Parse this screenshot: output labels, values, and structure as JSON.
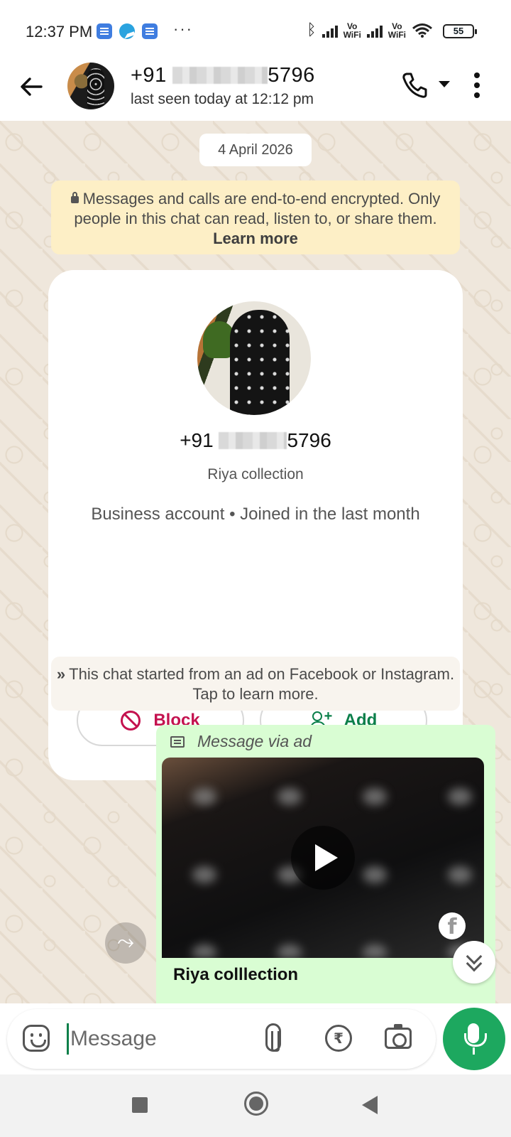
{
  "status_bar": {
    "time": "12:37 PM",
    "more": "···",
    "vowifi_label": "Vo\nWiFi",
    "battery": "55",
    "icons": [
      "notification-app-icon",
      "telegram-icon",
      "notification-app-icon",
      "bluetooth-icon",
      "signal-icon",
      "vowifi-icon",
      "signal-icon",
      "vowifi-icon",
      "wifi-icon",
      "battery-icon"
    ]
  },
  "header": {
    "number_prefix": "+91",
    "number_suffix": "5796",
    "last_seen": "last seen today at 12:12 pm",
    "icons": [
      "back-arrow-icon",
      "voice-call-icon",
      "caret-down-icon",
      "more-vertical-icon"
    ]
  },
  "chat": {
    "date": "4 April 2026",
    "encryption": {
      "text": "Messages and calls are end-to-end encrypted. Only people in this chat can read, listen to, or share them.",
      "link": "Learn more"
    },
    "business_card": {
      "number_prefix": "+91",
      "number_suffix": "5796",
      "name": "Riya collection",
      "description": "Business account • Joined in the last month",
      "block_label": "Block",
      "add_label": "Add"
    },
    "ad_notice": {
      "icon": "»",
      "text": "This chat started from an ad on Facebook or Instagram. Tap to learn more."
    },
    "ad_message": {
      "label": "Message via ad",
      "caption": "Riya colllection",
      "fb_glyph": "f"
    },
    "forward_glyph": "⤳"
  },
  "composer": {
    "placeholder": "Message",
    "rupee_glyph": "₹"
  },
  "colors": {
    "accent_green": "#1da85f",
    "block_red": "#c4124f",
    "add_green": "#0b7f4a",
    "bubble_green": "#d9fdd3",
    "encryption_bg": "#fdefc6"
  }
}
